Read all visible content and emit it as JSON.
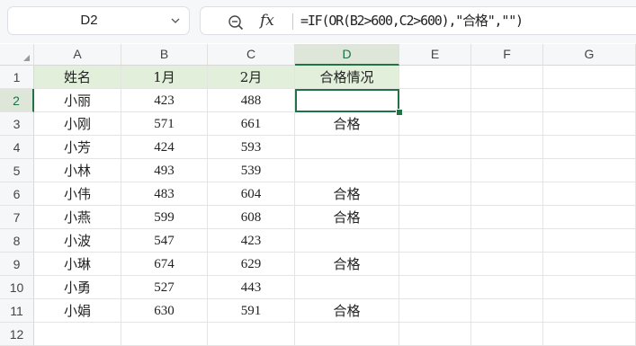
{
  "formula_bar": {
    "name_box": "D2",
    "zoom_icon": "zoom-icon",
    "fx_label": "fx",
    "formula": "=IF(OR(B2>600,C2>600),\"合格\",\"\")"
  },
  "columns": [
    "A",
    "B",
    "C",
    "D",
    "E",
    "F",
    "G"
  ],
  "rows": [
    "1",
    "2",
    "3",
    "4",
    "5",
    "6",
    "7",
    "8",
    "9",
    "10",
    "11",
    "12"
  ],
  "selected_cell": "D2",
  "sheet": {
    "header": {
      "name": "姓名",
      "jan": "1月",
      "feb": "2月",
      "status": "合格情况"
    },
    "data": [
      {
        "name": "小丽",
        "jan": "423",
        "feb": "488",
        "status": ""
      },
      {
        "name": "小刚",
        "jan": "571",
        "feb": "661",
        "status": "合格"
      },
      {
        "name": "小芳",
        "jan": "424",
        "feb": "593",
        "status": ""
      },
      {
        "name": "小林",
        "jan": "493",
        "feb": "539",
        "status": ""
      },
      {
        "name": "小伟",
        "jan": "483",
        "feb": "604",
        "status": "合格"
      },
      {
        "name": "小燕",
        "jan": "599",
        "feb": "608",
        "status": "合格"
      },
      {
        "name": "小波",
        "jan": "547",
        "feb": "423",
        "status": ""
      },
      {
        "name": "小琳",
        "jan": "674",
        "feb": "629",
        "status": "合格"
      },
      {
        "name": "小勇",
        "jan": "527",
        "feb": "443",
        "status": ""
      },
      {
        "name": "小娟",
        "jan": "630",
        "feb": "591",
        "status": "合格"
      }
    ]
  },
  "colors": {
    "accent": "#217346",
    "header_fill": "#e2efda",
    "selected_header": "#dde6d8"
  }
}
